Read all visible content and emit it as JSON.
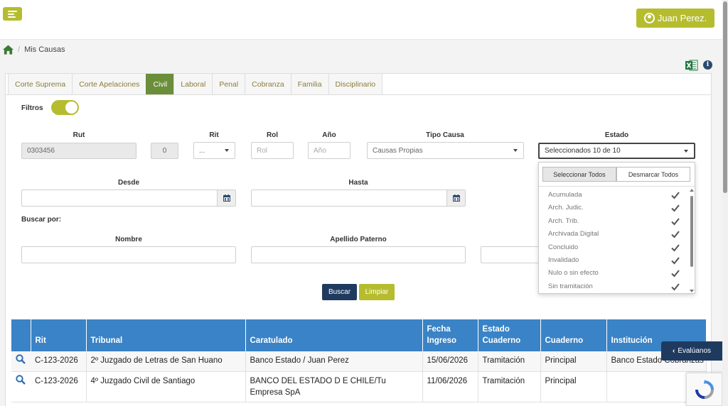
{
  "header": {
    "user_name": "Juan Perez."
  },
  "breadcrumb": {
    "current": "Mis Causas"
  },
  "tabs": [
    "Corte Suprema",
    "Corte Apelaciones",
    "Civil",
    "Laboral",
    "Penal",
    "Cobranza",
    "Familia",
    "Disciplinario"
  ],
  "active_tab": "Civil",
  "filters": {
    "toggle_label": "Filtros",
    "toggle_on": true,
    "rut_label": "Rut",
    "rut_value": "0303456",
    "rut_dv": "0",
    "rit_label": "Rit",
    "rit_value": "...",
    "rol_label": "Rol",
    "rol_placeholder": "Rol",
    "anio_label": "Año",
    "anio_placeholder": "Año",
    "tipo_causa_label": "Tipo Causa",
    "tipo_causa_value": "Causas Propias",
    "estado_label": "Estado",
    "estado_value": "Seleccionados 10 de 10",
    "desde_label": "Desde",
    "hasta_label": "Hasta",
    "buscar_por_label": "Buscar por:",
    "nombre_label": "Nombre",
    "apellido_label": "Apellido Paterno"
  },
  "estado_dropdown": {
    "select_all": "Seleccionar Todos",
    "deselect_all": "Desmarcar Todos",
    "options": [
      "Acumulada",
      "Arch. Judic.",
      "Arch. Trib.",
      "Archivada Digital",
      "Concluido",
      "Invalidado",
      "Nulo o sin efecto",
      "Sin tramitación"
    ]
  },
  "actions": {
    "search": "Buscar",
    "clear": "Limpiar"
  },
  "table": {
    "headers": [
      "Rit",
      "Tribunal",
      "Caratulado",
      "Fecha Ingreso",
      "Estado Cuaderno",
      "Cuaderno",
      "Institución"
    ],
    "rows": [
      [
        "C-123-2026",
        "2º Juzgado de Letras de San Huano",
        "Banco Estado / Juan Perez",
        "15/06/2026",
        "Tramitación",
        "Principal",
        "Banco Estado Cobranzas"
      ],
      [
        "C-123-2026",
        "4º Juzgado Civil de Santiago",
        "BANCO DEL ESTADO D E CHILE/Tu Empresa SpA",
        "11/06/2026",
        "Tramitación",
        "Principal",
        ""
      ]
    ]
  },
  "feedback": {
    "label": "Evalúanos"
  },
  "colors": {
    "accent": "#b5bd2f",
    "navy": "#1f3a5f",
    "table_header": "#3a83c6",
    "active_tab": "#6a8e3a"
  }
}
